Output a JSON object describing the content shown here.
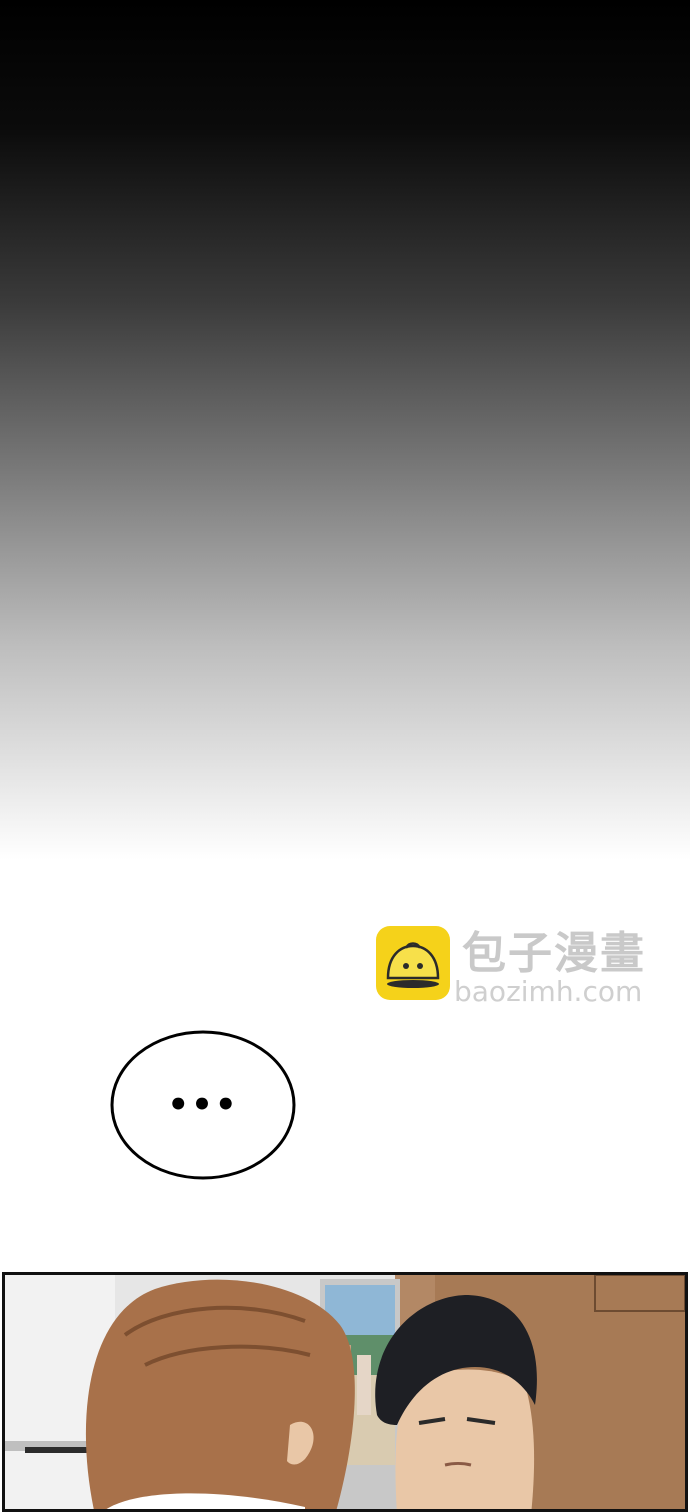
{
  "watermark": {
    "brand_cn": "包子漫畫",
    "url": "baozimh.com",
    "logo_color": "#f5d21a"
  },
  "speech_bubble": {
    "text": "•••"
  },
  "panel": {
    "scene": "two-characters-interior"
  },
  "colors": {
    "gradient_top": "#000000",
    "gradient_bottom": "#ffffff",
    "hair_brown": "#a8714a",
    "hair_black": "#1e1f24",
    "skin": "#e9c7a7",
    "wood_panel": "#a77a55"
  }
}
